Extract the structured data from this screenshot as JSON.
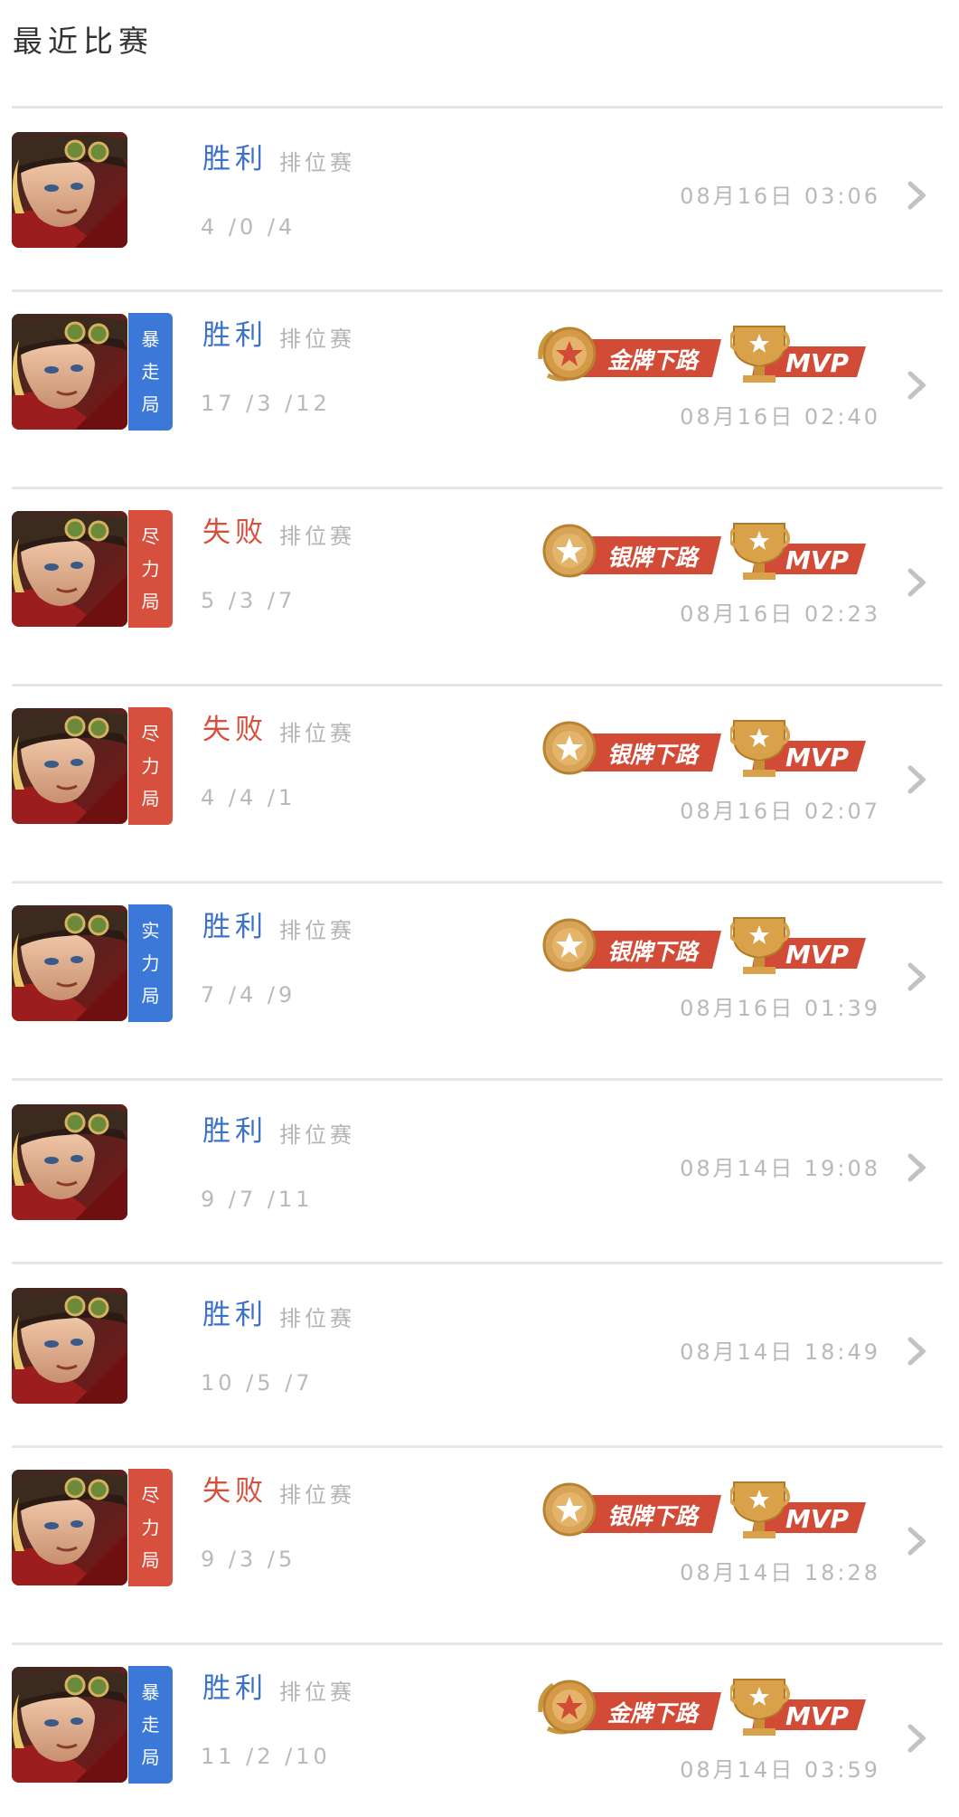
{
  "page": {
    "title": "最近比赛"
  },
  "colors": {
    "win": "#3b72c9",
    "loss": "#d6503d",
    "tier_blue": "#3c78d8",
    "tier_red": "#d6503d",
    "muted_text": "#b9b9b9",
    "divider": "#e6e6e6",
    "badge_red": "#d24b36",
    "badge_gold": "#d4a04c"
  },
  "matches": [
    {
      "result": "胜利",
      "outcome": "win",
      "mode": "排位赛",
      "kda": "4 /0 /4",
      "datetime": "08月16日 03:06",
      "tier": null,
      "medal": null,
      "mvp": null,
      "avatar_icon": "hero-portrait-icon",
      "arrow_icon": "chevron-right-icon"
    },
    {
      "result": "胜利",
      "outcome": "win",
      "mode": "排位赛",
      "kda": "17 /3 /12",
      "datetime": "08月16日 02:40",
      "tier": {
        "chars": [
          "暴",
          "走",
          "局"
        ],
        "color": "blue"
      },
      "medal": {
        "text": "金牌下路",
        "kind": "gold"
      },
      "mvp": "MVP",
      "avatar_icon": "hero-portrait-icon",
      "arrow_icon": "chevron-right-icon"
    },
    {
      "result": "失败",
      "outcome": "loss",
      "mode": "排位赛",
      "kda": "5 /3 /7",
      "datetime": "08月16日 02:23",
      "tier": {
        "chars": [
          "尽",
          "力",
          "局"
        ],
        "color": "red"
      },
      "medal": {
        "text": "银牌下路",
        "kind": "silver"
      },
      "mvp": "MVP",
      "avatar_icon": "hero-portrait-icon",
      "arrow_icon": "chevron-right-icon"
    },
    {
      "result": "失败",
      "outcome": "loss",
      "mode": "排位赛",
      "kda": "4 /4 /1",
      "datetime": "08月16日 02:07",
      "tier": {
        "chars": [
          "尽",
          "力",
          "局"
        ],
        "color": "red"
      },
      "medal": {
        "text": "银牌下路",
        "kind": "silver"
      },
      "mvp": "MVP",
      "avatar_icon": "hero-portrait-icon",
      "arrow_icon": "chevron-right-icon"
    },
    {
      "result": "胜利",
      "outcome": "win",
      "mode": "排位赛",
      "kda": "7 /4 /9",
      "datetime": "08月16日 01:39",
      "tier": {
        "chars": [
          "实",
          "力",
          "局"
        ],
        "color": "blue"
      },
      "medal": {
        "text": "银牌下路",
        "kind": "silver"
      },
      "mvp": "MVP",
      "avatar_icon": "hero-portrait-icon",
      "arrow_icon": "chevron-right-icon"
    },
    {
      "result": "胜利",
      "outcome": "win",
      "mode": "排位赛",
      "kda": "9 /7 /11",
      "datetime": "08月14日 19:08",
      "tier": null,
      "medal": null,
      "mvp": null,
      "avatar_icon": "hero-portrait-icon",
      "arrow_icon": "chevron-right-icon"
    },
    {
      "result": "胜利",
      "outcome": "win",
      "mode": "排位赛",
      "kda": "10 /5 /7",
      "datetime": "08月14日 18:49",
      "tier": null,
      "medal": null,
      "mvp": null,
      "avatar_icon": "hero-portrait-icon",
      "arrow_icon": "chevron-right-icon"
    },
    {
      "result": "失败",
      "outcome": "loss",
      "mode": "排位赛",
      "kda": "9 /3 /5",
      "datetime": "08月14日 18:28",
      "tier": {
        "chars": [
          "尽",
          "力",
          "局"
        ],
        "color": "red"
      },
      "medal": {
        "text": "银牌下路",
        "kind": "silver"
      },
      "mvp": "MVP",
      "avatar_icon": "hero-portrait-icon",
      "arrow_icon": "chevron-right-icon"
    },
    {
      "result": "胜利",
      "outcome": "win",
      "mode": "排位赛",
      "kda": "11 /2 /10",
      "datetime": "08月14日 03:59",
      "tier": {
        "chars": [
          "暴",
          "走",
          "局"
        ],
        "color": "blue"
      },
      "medal": {
        "text": "金牌下路",
        "kind": "gold"
      },
      "mvp": "MVP",
      "avatar_icon": "hero-portrait-icon",
      "arrow_icon": "chevron-right-icon"
    }
  ]
}
